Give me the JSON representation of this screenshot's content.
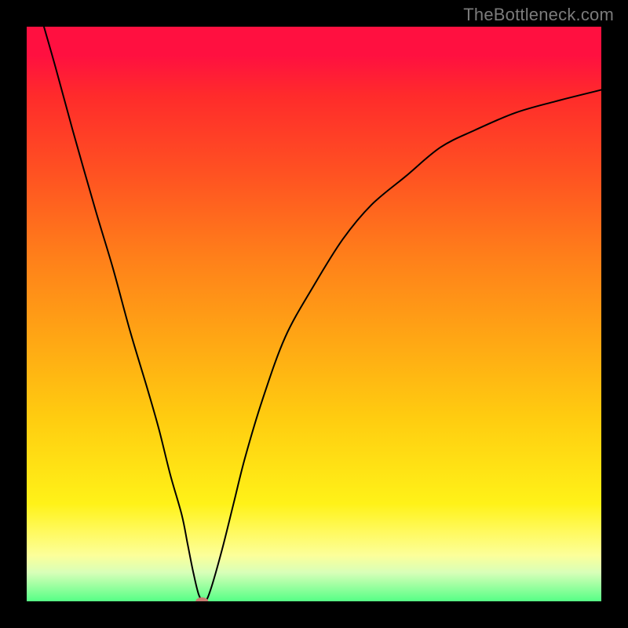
{
  "watermark": "TheBottleneck.com",
  "chart_data": {
    "type": "line",
    "title": "",
    "xlabel": "",
    "ylabel": "",
    "xlim": [
      0,
      100
    ],
    "ylim": [
      0,
      100
    ],
    "grid": false,
    "legend": false,
    "series": [
      {
        "name": "bottleneck-curve",
        "x": [
          3,
          5,
          8,
          12,
          15,
          18,
          21,
          23,
          25,
          27,
          28,
          29,
          30,
          31,
          32,
          34,
          36,
          38,
          41,
          45,
          50,
          55,
          60,
          66,
          72,
          78,
          85,
          92,
          100
        ],
        "values": [
          100,
          93,
          82,
          68,
          58,
          47,
          37,
          30,
          22,
          15,
          10,
          5,
          1,
          0,
          2,
          9,
          17,
          25,
          35,
          46,
          55,
          63,
          69,
          74,
          79,
          82,
          85,
          87,
          89
        ]
      }
    ],
    "marker": {
      "label": "min-point",
      "x": 30.5,
      "y": 0,
      "color": "#c97a70",
      "rx": 8,
      "ry": 5
    },
    "background_gradient": {
      "top": "#ff1040",
      "bottom": "#56ff86",
      "stops": [
        "#ff1040",
        "#ff2b2b",
        "#ff5022",
        "#ff7f1a",
        "#ffa015",
        "#ffcc10",
        "#fff218",
        "#fffa60",
        "#fcff9a",
        "#d8ffb8",
        "#56ff86"
      ]
    }
  }
}
